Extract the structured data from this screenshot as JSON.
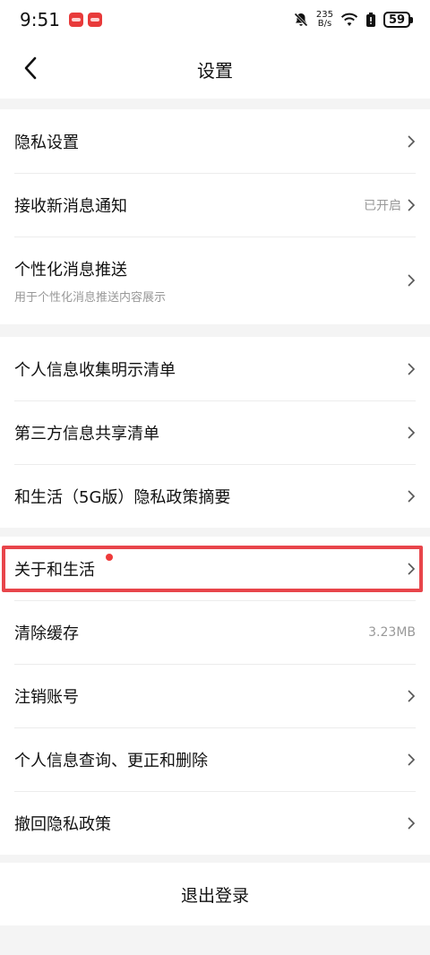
{
  "status_bar": {
    "time": "9:51",
    "net_speed_value": "235",
    "net_speed_unit": "B/s",
    "battery": "59",
    "icons": [
      "app-badge-icon",
      "app-badge-icon",
      "bell-muted-icon",
      "wifi-icon",
      "battery-saver-icon",
      "battery-icon"
    ]
  },
  "header": {
    "title": "设置",
    "back_icon": "chevron-left-icon"
  },
  "group1": {
    "items": [
      {
        "label": "隐私设置"
      },
      {
        "label": "接收新消息通知",
        "value": "已开启"
      },
      {
        "label": "个性化消息推送",
        "subtitle": "用于个性化消息推送内容展示"
      }
    ]
  },
  "group2": {
    "items": [
      {
        "label": "个人信息收集明示清单"
      },
      {
        "label": "第三方信息共享清单"
      },
      {
        "label": "和生活（5G版）隐私政策摘要"
      }
    ]
  },
  "group3": {
    "items": [
      {
        "label": "关于和生活",
        "has_red_dot": true
      },
      {
        "label": "清除缓存",
        "value": "3.23MB"
      },
      {
        "label": "注销账号"
      },
      {
        "label": "个人信息查询、更正和删除"
      },
      {
        "label": "撤回隐私政策"
      }
    ]
  },
  "logout": {
    "label": "退出登录"
  },
  "colors": {
    "accent_red": "#e8454b",
    "text_primary": "#111111",
    "text_secondary": "#999999",
    "background": "#f4f4f4"
  }
}
